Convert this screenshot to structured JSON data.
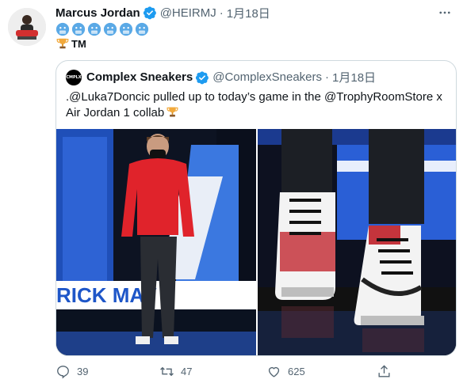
{
  "tweet": {
    "display_name": "Marcus Jordan",
    "handle": "@HEIRMJ",
    "date": "1月18日",
    "tm_text": "TM",
    "emoji_count": 6
  },
  "quoted_tweet": {
    "display_name": "Complex Sneakers",
    "handle": "@ComplexSneakers",
    "date": "1月18日",
    "text": ".@Luka7Doncic pulled up to today’s game in the @TrophyRoomStore x Air Jordan 1 collab",
    "left_image_banner_text": "RICK  MAV"
  },
  "actions": {
    "reply_count": "39",
    "retweet_count": "47",
    "like_count": "625",
    "share_count": ""
  },
  "colors": {
    "verified": "#1d9bf0",
    "muted": "#536471",
    "border": "#cfd9de"
  }
}
